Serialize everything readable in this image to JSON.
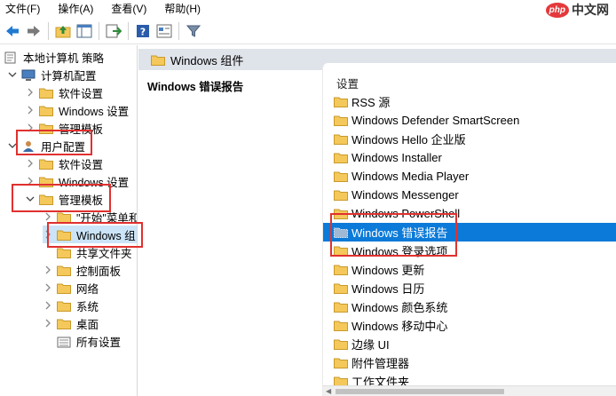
{
  "menu": [
    "文件(F)",
    "操作(A)",
    "查看(V)",
    "帮助(H)"
  ],
  "logo": {
    "badge": "php",
    "text": "中文网"
  },
  "tree": [
    {
      "label": "本地计算机 策略",
      "level": 0,
      "chevron": "none",
      "icon": "policy-icon"
    },
    {
      "label": "计算机配置",
      "level": 1,
      "chevron": "down",
      "icon": "computer-icon"
    },
    {
      "label": "软件设置",
      "level": 2,
      "chevron": "right",
      "icon": "folder-icon"
    },
    {
      "label": "Windows 设置",
      "level": 2,
      "chevron": "right",
      "icon": "folder-icon"
    },
    {
      "label": "管理模板",
      "level": 2,
      "chevron": "right",
      "icon": "folder-icon"
    },
    {
      "label": "用户配置",
      "level": 1,
      "chevron": "down",
      "icon": "user-icon"
    },
    {
      "label": "软件设置",
      "level": 2,
      "chevron": "right",
      "icon": "folder-icon"
    },
    {
      "label": "Windows 设置",
      "level": 2,
      "chevron": "right",
      "icon": "folder-icon"
    },
    {
      "label": "管理模板",
      "level": 2,
      "chevron": "down",
      "icon": "folder-icon"
    },
    {
      "label": "\"开始\"菜单和",
      "level": 3,
      "chevron": "right",
      "icon": "folder-icon"
    },
    {
      "label": "Windows 组",
      "level": 3,
      "chevron": "right",
      "icon": "folder-icon",
      "selected": true
    },
    {
      "label": "共享文件夹",
      "level": 3,
      "chevron": "none",
      "icon": "folder-icon"
    },
    {
      "label": "控制面板",
      "level": 3,
      "chevron": "right",
      "icon": "folder-icon"
    },
    {
      "label": "网络",
      "level": 3,
      "chevron": "right",
      "icon": "folder-icon"
    },
    {
      "label": "系统",
      "level": 3,
      "chevron": "right",
      "icon": "folder-icon"
    },
    {
      "label": "桌面",
      "level": 3,
      "chevron": "right",
      "icon": "folder-icon"
    },
    {
      "label": "所有设置",
      "level": 3,
      "chevron": "none",
      "icon": "settings-list-icon"
    }
  ],
  "middle": {
    "header": "Windows 组件",
    "desc_title": "Windows 错误报告"
  },
  "list": {
    "column_header": "设置",
    "items": [
      {
        "label": "RSS 源"
      },
      {
        "label": "Windows Defender SmartScreen"
      },
      {
        "label": "Windows Hello 企业版"
      },
      {
        "label": "Windows Installer"
      },
      {
        "label": "Windows Media Player"
      },
      {
        "label": "Windows Messenger"
      },
      {
        "label": "Windows PowerShell"
      },
      {
        "label": "Windows 错误报告",
        "selected": true
      },
      {
        "label": "Windows 登录选项"
      },
      {
        "label": "Windows 更新"
      },
      {
        "label": "Windows 日历"
      },
      {
        "label": "Windows 颜色系统"
      },
      {
        "label": "Windows 移动中心"
      },
      {
        "label": "边缘 UI"
      },
      {
        "label": "附件管理器"
      },
      {
        "label": "工作文件夹"
      }
    ]
  },
  "colors": {
    "selection": "#0c7ad8",
    "highlight": "#e0312f",
    "folder": "#f4c85a"
  }
}
